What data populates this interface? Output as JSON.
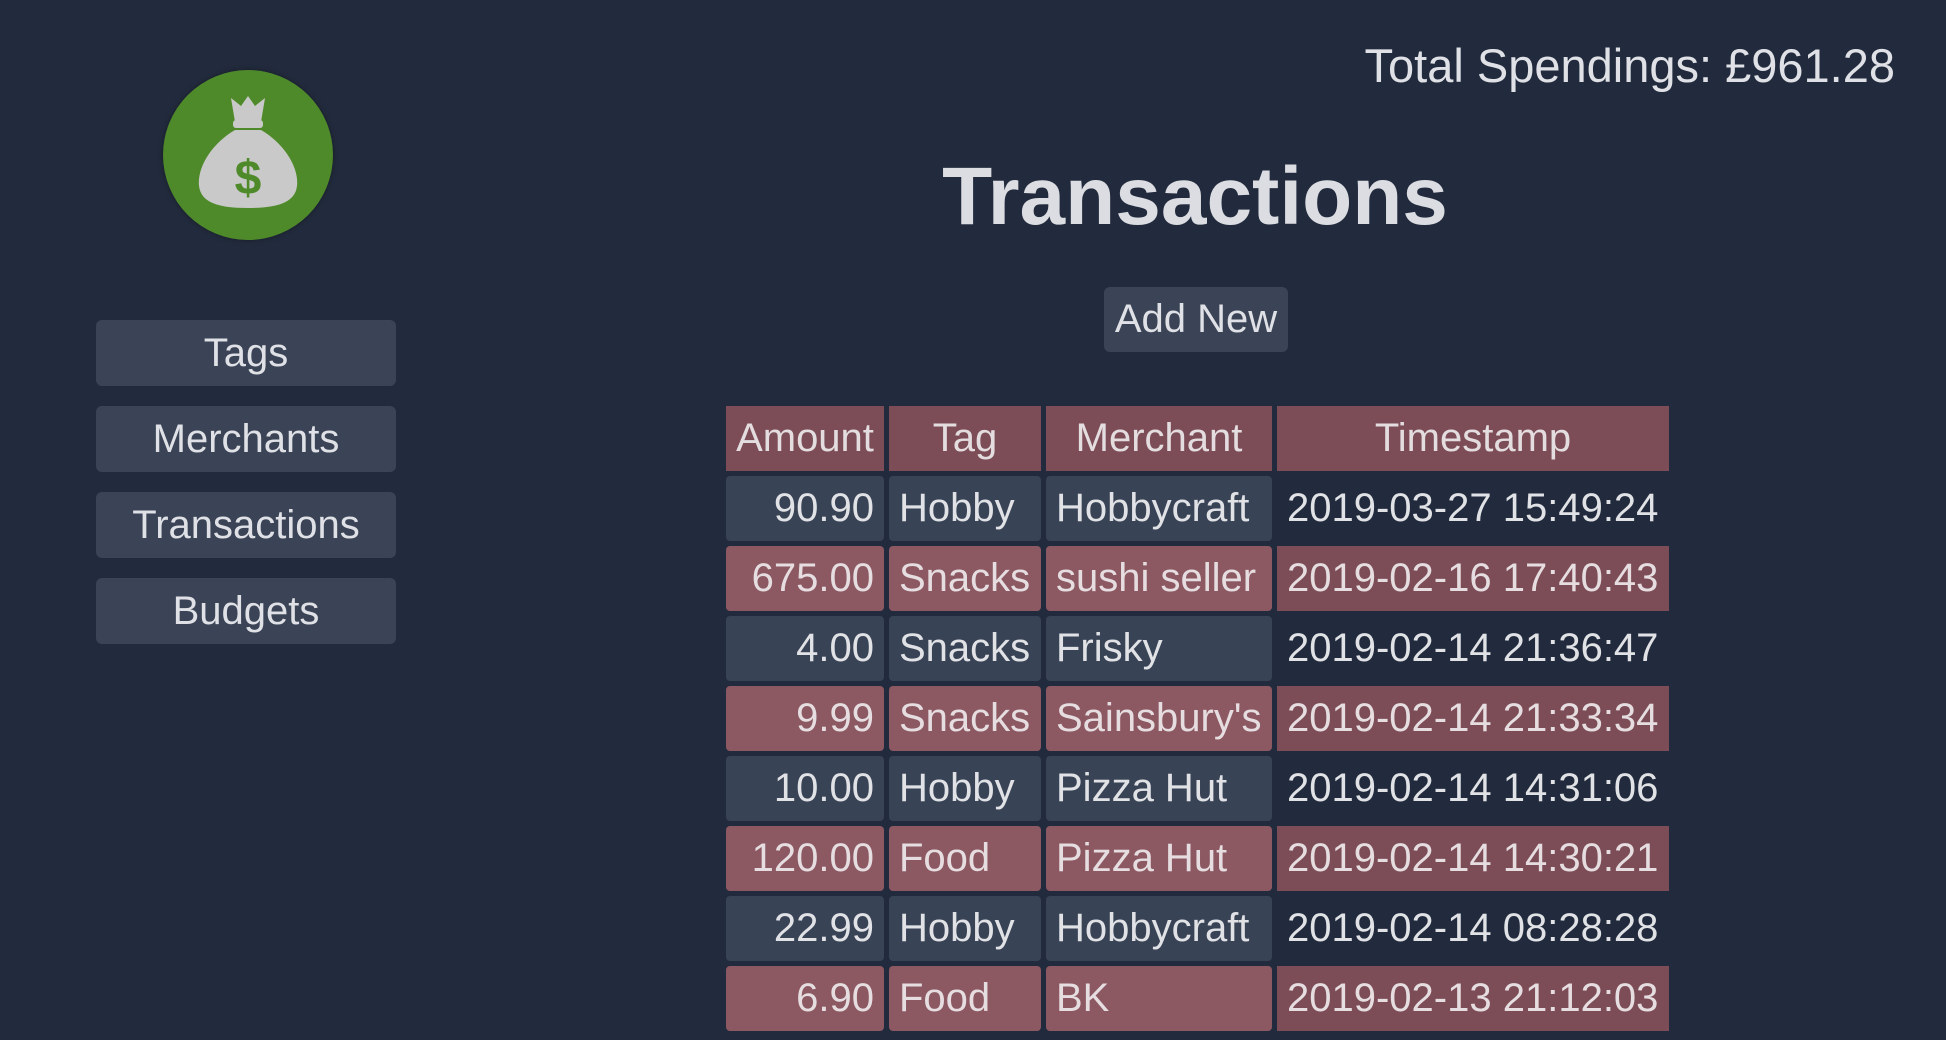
{
  "header": {
    "total_label": "Total Spendings: £961.28",
    "title": "Transactions",
    "add_new_label": "Add New"
  },
  "logo": {
    "icon": "money-bag-icon",
    "symbol": "$",
    "color": "#4f8a2a"
  },
  "sidebar": {
    "items": [
      {
        "label": "Tags"
      },
      {
        "label": "Merchants"
      },
      {
        "label": "Transactions"
      },
      {
        "label": "Budgets"
      }
    ]
  },
  "table": {
    "columns": [
      "Amount",
      "Tag",
      "Merchant",
      "Timestamp"
    ],
    "rows": [
      {
        "amount": "90.90",
        "tag": "Hobby",
        "merchant": "Hobbycraft",
        "timestamp": "2019-03-27 15:49:24",
        "highlight": false
      },
      {
        "amount": "675.00",
        "tag": "Snacks",
        "merchant": "sushi seller",
        "timestamp": "2019-02-16 17:40:43",
        "highlight": true
      },
      {
        "amount": "4.00",
        "tag": "Snacks",
        "merchant": "Frisky",
        "timestamp": "2019-02-14 21:36:47",
        "highlight": false
      },
      {
        "amount": "9.99",
        "tag": "Snacks",
        "merchant": "Sainsbury's",
        "timestamp": "2019-02-14 21:33:34",
        "highlight": true
      },
      {
        "amount": "10.00",
        "tag": "Hobby",
        "merchant": "Pizza Hut",
        "timestamp": "2019-02-14 14:31:06",
        "highlight": false
      },
      {
        "amount": "120.00",
        "tag": "Food",
        "merchant": "Pizza Hut",
        "timestamp": "2019-02-14 14:30:21",
        "highlight": true
      },
      {
        "amount": "22.99",
        "tag": "Hobby",
        "merchant": "Hobbycraft",
        "timestamp": "2019-02-14 08:28:28",
        "highlight": false
      },
      {
        "amount": "6.90",
        "tag": "Food",
        "merchant": "BK",
        "timestamp": "2019-02-13 21:12:03",
        "highlight": true
      }
    ]
  },
  "colors": {
    "background": "#222b3d",
    "button": "#3a4456",
    "header_cell": "#7d4d57",
    "highlight_cell": "#8c5862"
  }
}
